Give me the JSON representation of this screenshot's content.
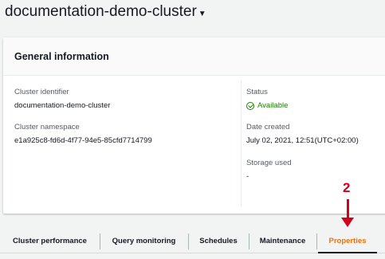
{
  "header": {
    "title": "documentation-demo-cluster",
    "caret_icon": "caret-down-icon"
  },
  "panel": {
    "title": "General information",
    "left": {
      "cluster_identifier_label": "Cluster identifier",
      "cluster_identifier_value": "documentation-demo-cluster",
      "cluster_namespace_label": "Cluster namespace",
      "cluster_namespace_value": "e1a925c8-fd6d-4f77-94e5-85cfd7714799"
    },
    "right": {
      "status_label": "Status",
      "status_value": "Available",
      "status_icon": "check-circle-icon",
      "status_color": "#1d8102",
      "date_created_label": "Date created",
      "date_created_value": "July 02, 2021, 12:51(UTC+02:00)",
      "storage_used_label": "Storage used",
      "storage_used_value": "-"
    }
  },
  "annotation": {
    "number": "2",
    "color": "#d0021b"
  },
  "tabs": [
    {
      "label": "Cluster performance",
      "active": false
    },
    {
      "label": "Query monitoring",
      "active": false
    },
    {
      "label": "Schedules",
      "active": false
    },
    {
      "label": "Maintenance",
      "active": false
    },
    {
      "label": "Properties",
      "active": true
    }
  ],
  "colors": {
    "active_tab": "#ec7211"
  }
}
